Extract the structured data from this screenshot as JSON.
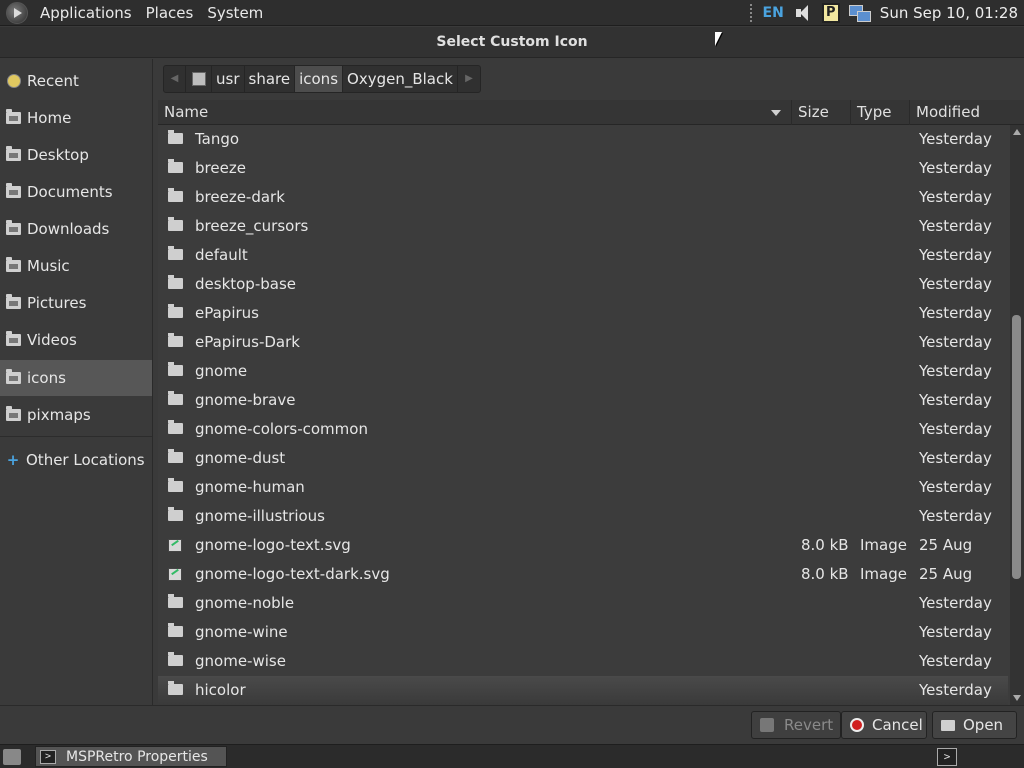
{
  "top_panel": {
    "menus": [
      "Applications",
      "Places",
      "System"
    ],
    "lang": "EN",
    "p_indicator": "P",
    "clock": "Sun Sep 10, 01:28"
  },
  "dialog": {
    "title": "Select Custom Icon"
  },
  "sidebar": {
    "items": [
      {
        "label": "Recent",
        "icon": "recent-icon"
      },
      {
        "label": "Home",
        "icon": "folder-icon"
      },
      {
        "label": "Desktop",
        "icon": "folder-icon"
      },
      {
        "label": "Documents",
        "icon": "folder-icon"
      },
      {
        "label": "Downloads",
        "icon": "folder-icon"
      },
      {
        "label": "Music",
        "icon": "folder-icon"
      },
      {
        "label": "Pictures",
        "icon": "folder-icon"
      },
      {
        "label": "Videos",
        "icon": "folder-icon"
      },
      {
        "label": "icons",
        "icon": "folder-icon",
        "active": true
      },
      {
        "label": "pixmaps",
        "icon": "folder-icon"
      },
      {
        "label": "Other Locations",
        "icon": "plus-icon"
      }
    ]
  },
  "path": {
    "segments": [
      "usr",
      "share",
      "icons",
      "Oxygen_Black"
    ],
    "active_index": 2
  },
  "columns": {
    "name": "Name",
    "size": "Size",
    "type": "Type",
    "modified": "Modified"
  },
  "files": [
    {
      "name": "Tango",
      "size": "",
      "type": "",
      "modified": "Yesterday",
      "kind": "folder"
    },
    {
      "name": "breeze",
      "size": "",
      "type": "",
      "modified": "Yesterday",
      "kind": "folder"
    },
    {
      "name": "breeze-dark",
      "size": "",
      "type": "",
      "modified": "Yesterday",
      "kind": "folder"
    },
    {
      "name": "breeze_cursors",
      "size": "",
      "type": "",
      "modified": "Yesterday",
      "kind": "folder"
    },
    {
      "name": "default",
      "size": "",
      "type": "",
      "modified": "Yesterday",
      "kind": "folder"
    },
    {
      "name": "desktop-base",
      "size": "",
      "type": "",
      "modified": "Yesterday",
      "kind": "folder"
    },
    {
      "name": "ePapirus",
      "size": "",
      "type": "",
      "modified": "Yesterday",
      "kind": "folder"
    },
    {
      "name": "ePapirus-Dark",
      "size": "",
      "type": "",
      "modified": "Yesterday",
      "kind": "folder"
    },
    {
      "name": "gnome",
      "size": "",
      "type": "",
      "modified": "Yesterday",
      "kind": "folder"
    },
    {
      "name": "gnome-brave",
      "size": "",
      "type": "",
      "modified": "Yesterday",
      "kind": "folder"
    },
    {
      "name": "gnome-colors-common",
      "size": "",
      "type": "",
      "modified": "Yesterday",
      "kind": "folder"
    },
    {
      "name": "gnome-dust",
      "size": "",
      "type": "",
      "modified": "Yesterday",
      "kind": "folder"
    },
    {
      "name": "gnome-human",
      "size": "",
      "type": "",
      "modified": "Yesterday",
      "kind": "folder"
    },
    {
      "name": "gnome-illustrious",
      "size": "",
      "type": "",
      "modified": "Yesterday",
      "kind": "folder"
    },
    {
      "name": "gnome-logo-text.svg",
      "size": "8.0 kB",
      "type": "Image",
      "modified": "25 Aug",
      "kind": "image"
    },
    {
      "name": "gnome-logo-text-dark.svg",
      "size": "8.0 kB",
      "type": "Image",
      "modified": "25 Aug",
      "kind": "image"
    },
    {
      "name": "gnome-noble",
      "size": "",
      "type": "",
      "modified": "Yesterday",
      "kind": "folder"
    },
    {
      "name": "gnome-wine",
      "size": "",
      "type": "",
      "modified": "Yesterday",
      "kind": "folder"
    },
    {
      "name": "gnome-wise",
      "size": "",
      "type": "",
      "modified": "Yesterday",
      "kind": "folder"
    },
    {
      "name": "hicolor",
      "size": "",
      "type": "",
      "modified": "Yesterday",
      "kind": "folder"
    }
  ],
  "buttons": {
    "revert": "Revert",
    "cancel": "Cancel",
    "open": "Open"
  },
  "taskbar": {
    "task_label": "MSPRetro Properties",
    "term_glyph": ">"
  }
}
